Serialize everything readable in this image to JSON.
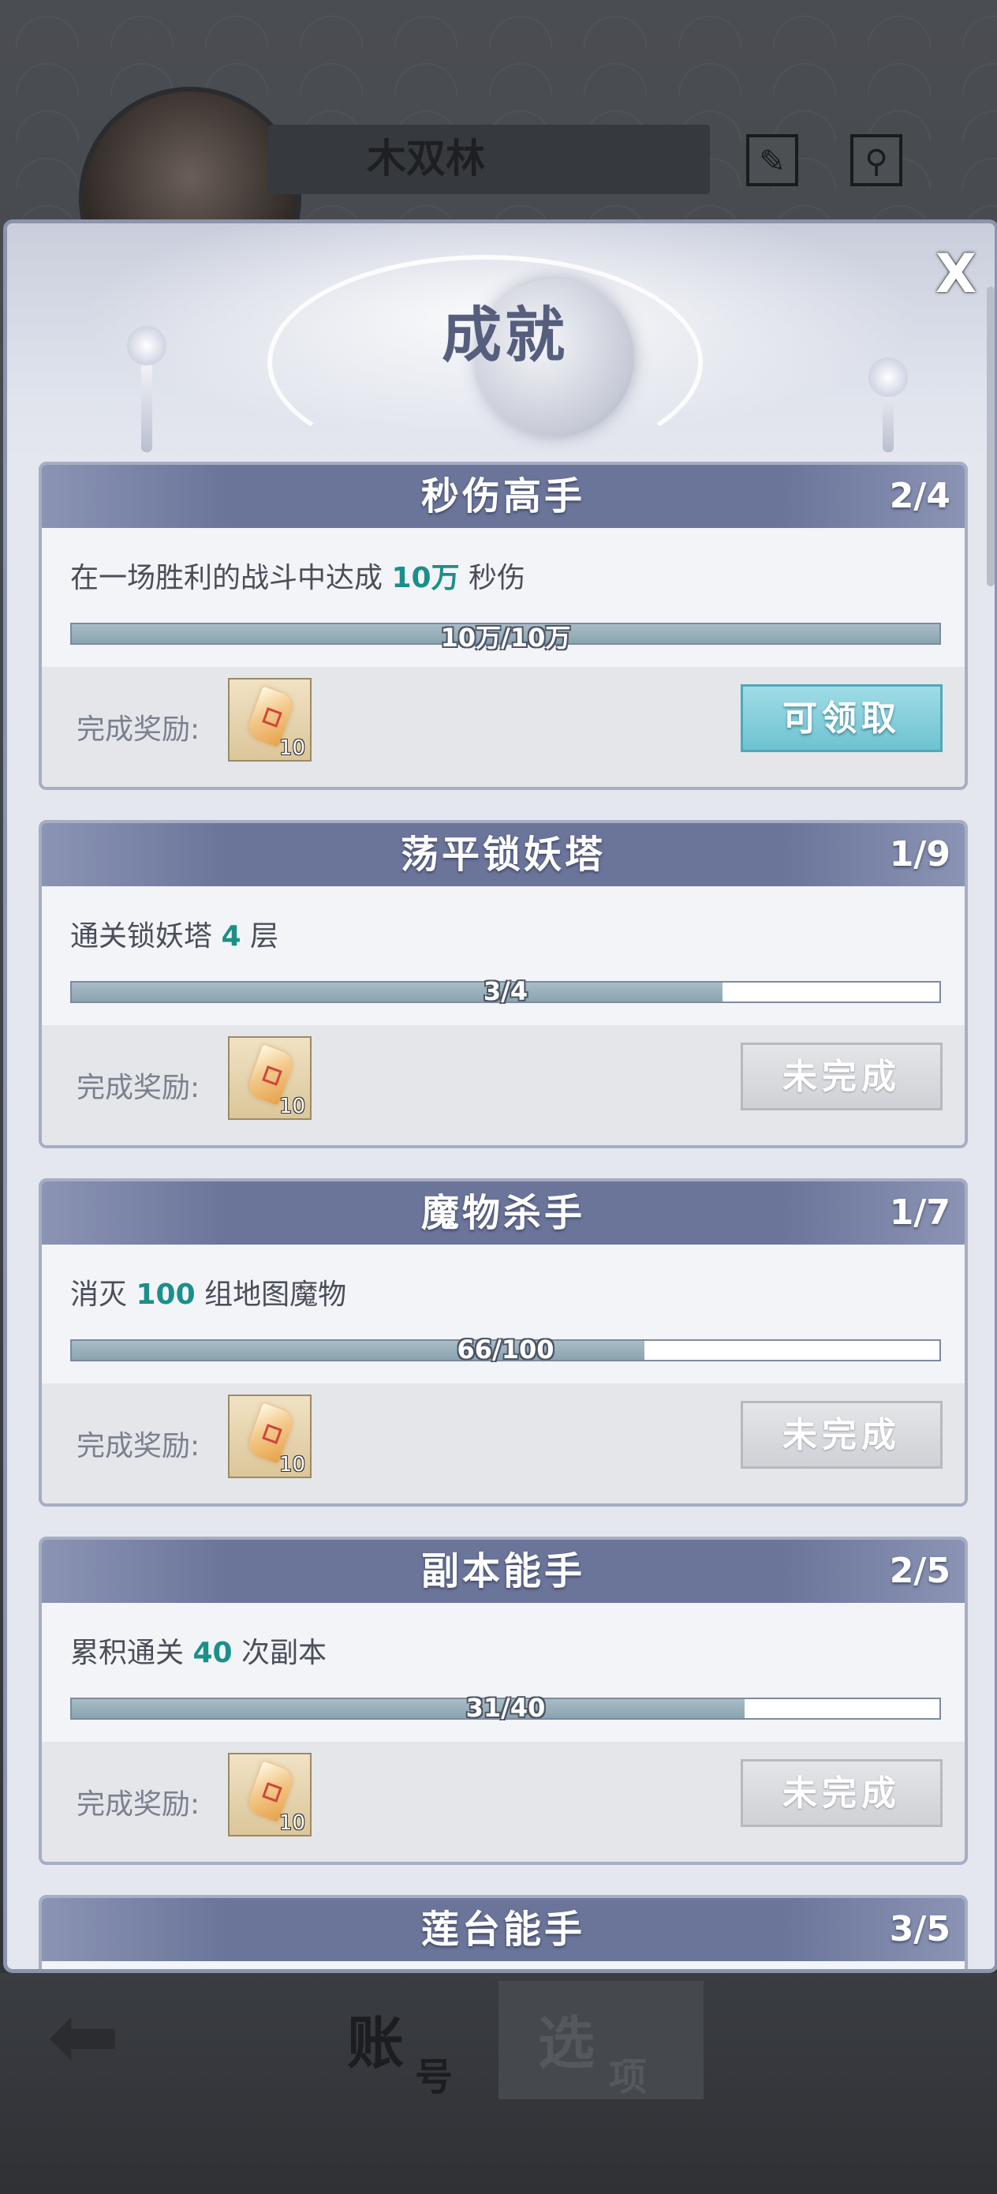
{
  "background": {
    "player_name": "木双林",
    "header_icons": [
      "brush-icon",
      "settings-icon"
    ],
    "bottom_bar": {
      "account_tab": [
        "账",
        "号"
      ],
      "options_tab": [
        "选",
        "项"
      ]
    }
  },
  "dialog": {
    "title": "成就",
    "close_label": "X",
    "reward_label": "完成奖励:",
    "accent_color": "#1b8f8a",
    "claim_button_color": "#6ec3d2",
    "achievements": [
      {
        "title": "秒伤高手",
        "count": "2/4",
        "desc_prefix": "在一场胜利的战斗中达成",
        "desc_value": "10万",
        "desc_suffix": "秒伤",
        "progress_text": "10万/10万",
        "progress": 1.0,
        "reward_qty": "10",
        "button_label": "可领取",
        "button_state": "claimable"
      },
      {
        "title": "荡平锁妖塔",
        "count": "1/9",
        "desc_prefix": "通关锁妖塔",
        "desc_value": "4",
        "desc_suffix": "层",
        "progress_text": "3/4",
        "progress": 0.75,
        "reward_qty": "10",
        "button_label": "未完成",
        "button_state": "incomplete"
      },
      {
        "title": "魔物杀手",
        "count": "1/7",
        "desc_prefix": "消灭",
        "desc_value": "100",
        "desc_suffix": "组地图魔物",
        "progress_text": "66/100",
        "progress": 0.66,
        "reward_qty": "10",
        "button_label": "未完成",
        "button_state": "incomplete"
      },
      {
        "title": "副本能手",
        "count": "2/5",
        "desc_prefix": "累积通关",
        "desc_value": "40",
        "desc_suffix": "次副本",
        "progress_text": "31/40",
        "progress": 0.775,
        "reward_qty": "10",
        "button_label": "未完成",
        "button_state": "incomplete"
      },
      {
        "title": "莲台能手",
        "count": "3/5"
      }
    ]
  }
}
